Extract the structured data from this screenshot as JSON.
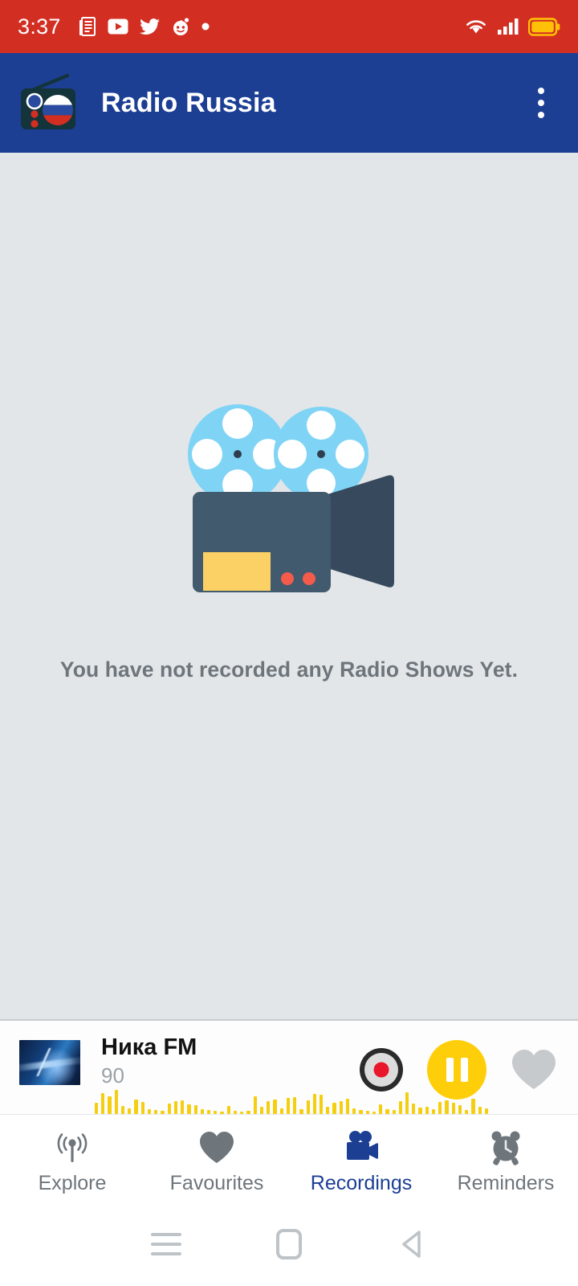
{
  "statusbar": {
    "time": "3:37",
    "left_icons": [
      "news-icon",
      "youtube-icon",
      "twitter-icon",
      "reddit-icon",
      "dot-icon"
    ],
    "right_icons": [
      "wifi-icon",
      "cell-signal-icon",
      "battery-icon"
    ],
    "background_color": "#D32E22",
    "battery_color": "#FFC107"
  },
  "appbar": {
    "title": "Radio Russia",
    "logo_icon": "radio-russia-logo",
    "overflow_icon": "overflow-menu-icon",
    "background_color": "#1C3F94"
  },
  "main": {
    "empty_state": {
      "illustration": "movie-camera-icon",
      "message": "You have not recorded any Radio Shows Yet."
    },
    "background_color": "#E2E6E9"
  },
  "player": {
    "thumbnail": "station-artwork",
    "station_name": "Ника FM",
    "frequency": "90",
    "record_icon": "record-icon",
    "pause_icon": "pause-icon",
    "favourite_icon": "heart-icon",
    "accent_color": "#FFCE0A",
    "waveform_color": "#F5CE10",
    "waveform_levels": [
      14,
      26,
      22,
      30,
      10,
      7,
      18,
      15,
      6,
      5,
      4,
      13,
      16,
      17,
      12,
      11,
      6,
      5,
      4,
      3,
      10,
      4,
      3,
      4,
      22,
      9,
      16,
      18,
      7,
      20,
      21,
      6,
      17,
      25,
      24,
      9,
      14,
      16,
      19,
      7,
      5,
      4,
      3,
      12,
      6,
      5,
      16,
      27,
      13,
      8,
      9,
      6,
      15,
      17,
      14,
      11,
      5,
      19,
      9,
      7
    ]
  },
  "bottomnav": {
    "active_index": 2,
    "active_color": "#1C3F94",
    "inactive_color": "#6E757B",
    "items": [
      {
        "label": "Explore",
        "icon": "broadcast-icon"
      },
      {
        "label": "Favourites",
        "icon": "heart-icon"
      },
      {
        "label": "Recordings",
        "icon": "video-camera-icon"
      },
      {
        "label": "Reminders",
        "icon": "alarm-clock-icon"
      }
    ]
  },
  "sysnav": {
    "items": [
      {
        "icon": "recents-icon"
      },
      {
        "icon": "home-icon"
      },
      {
        "icon": "back-icon"
      }
    ]
  }
}
